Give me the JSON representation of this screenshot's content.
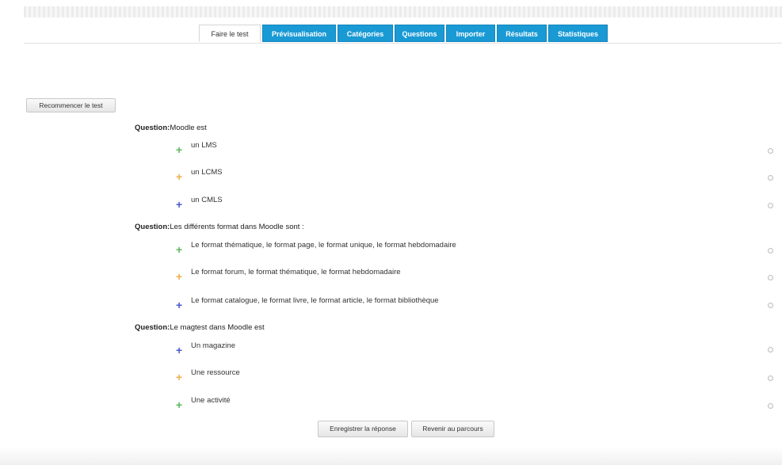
{
  "tabs": [
    {
      "label": "Faire le test",
      "active": true
    },
    {
      "label": "Prévisualisation",
      "active": false
    },
    {
      "label": "Catégories",
      "active": false
    },
    {
      "label": "Questions",
      "active": false
    },
    {
      "label": "Importer",
      "active": false
    },
    {
      "label": "Résultats",
      "active": false
    },
    {
      "label": "Statistiques",
      "active": false
    }
  ],
  "restart_button": "Recommencer le test",
  "question_prefix": "Question:",
  "questions": [
    {
      "text": "Moodle est",
      "answers": [
        {
          "label": "un LMS",
          "icon": "plus-icon",
          "color": "#5cb85c"
        },
        {
          "label": "un LCMS",
          "icon": "plus-icon",
          "color": "#f0ad4e"
        },
        {
          "label": "un CMLS",
          "icon": "plus-icon",
          "color": "#4a5bd0"
        }
      ]
    },
    {
      "text": "Les différents format dans Moodle sont :",
      "answers": [
        {
          "label": "Le format thématique, le format page, le format unique, le format hebdomadaire",
          "icon": "plus-icon",
          "color": "#5cb85c"
        },
        {
          "label": "Le format forum, le format thématique, le format hebdomadaire",
          "icon": "plus-icon",
          "color": "#f0ad4e"
        },
        {
          "label": "Le format catalogue, le format livre, le format article, le format bibliothèque",
          "icon": "plus-icon",
          "color": "#4a5bd0"
        }
      ]
    },
    {
      "text": "Le magtest dans Moodle est",
      "answers": [
        {
          "label": "Un magazine",
          "icon": "plus-icon",
          "color": "#4a5bd0"
        },
        {
          "label": "Une ressource",
          "icon": "plus-icon",
          "color": "#f0ad4e"
        },
        {
          "label": "Une activité",
          "icon": "plus-icon",
          "color": "#5cb85c"
        }
      ]
    }
  ],
  "save_button": "Enregistrer la réponse",
  "back_button": "Revenir au parcours"
}
